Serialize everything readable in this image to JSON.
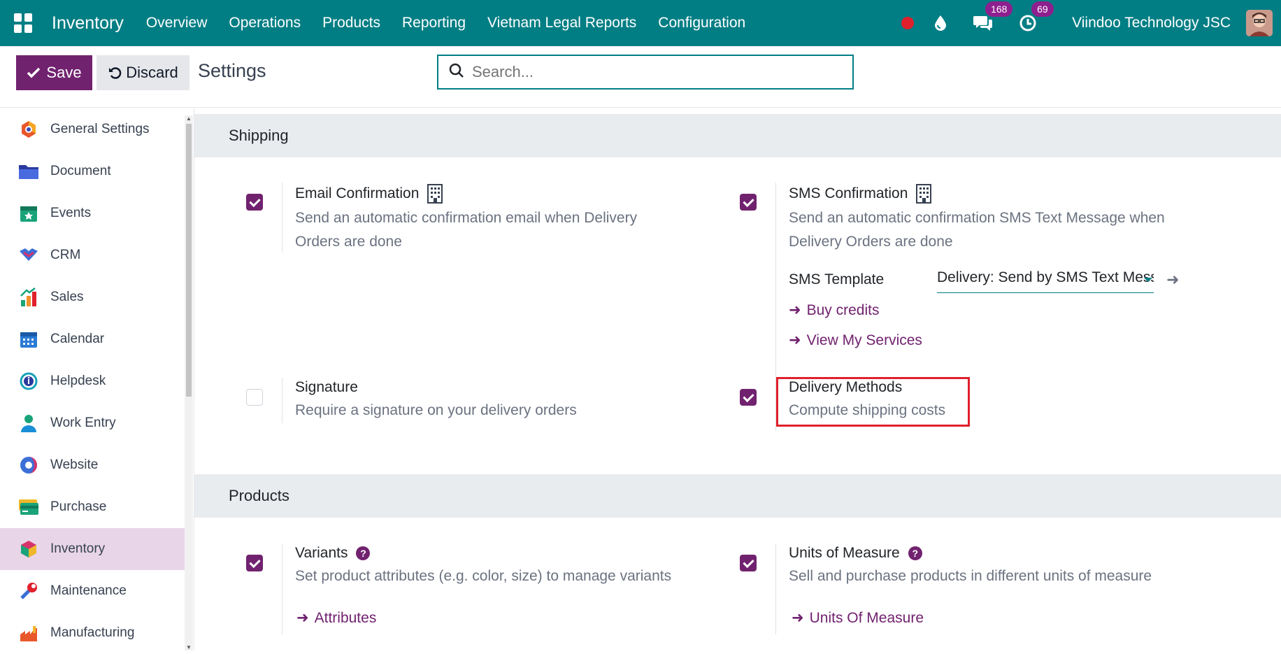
{
  "navbar": {
    "app_name": "Inventory",
    "menu": [
      "Overview",
      "Operations",
      "Products",
      "Reporting",
      "Vietnam Legal Reports",
      "Configuration"
    ],
    "messages_count": "168",
    "activities_count": "69",
    "company": "Viindoo Technology JSC",
    "icons": [
      "apps-grid-icon",
      "recording-dot-icon",
      "droplet-icon",
      "chat-icon",
      "clock-icon"
    ]
  },
  "control": {
    "save_label": "Save",
    "discard_label": "Discard",
    "title": "Settings",
    "search_placeholder": "Search..."
  },
  "sidebar": {
    "items": [
      {
        "label": "General Settings",
        "icon": "general-settings-icon",
        "color": "#e8582b"
      },
      {
        "label": "Document",
        "icon": "document-icon",
        "color": "#3b4cb8"
      },
      {
        "label": "Events",
        "icon": "events-icon",
        "color": "#1aa37a"
      },
      {
        "label": "CRM",
        "icon": "crm-icon",
        "color": "#3b6fd6"
      },
      {
        "label": "Sales",
        "icon": "sales-icon",
        "color": "#f0912b"
      },
      {
        "label": "Calendar",
        "icon": "calendar-icon",
        "color": "#2b7bd6"
      },
      {
        "label": "Helpdesk",
        "icon": "helpdesk-icon",
        "color": "#17a2b8"
      },
      {
        "label": "Work Entry",
        "icon": "work-entry-icon",
        "color": "#1a8fd6"
      },
      {
        "label": "Website",
        "icon": "website-icon",
        "color": "#3b6fd6"
      },
      {
        "label": "Purchase",
        "icon": "purchase-icon",
        "color": "#f0b72b"
      },
      {
        "label": "Inventory",
        "icon": "inventory-icon",
        "color": "#d6336c",
        "active": true
      },
      {
        "label": "Maintenance",
        "icon": "maintenance-icon",
        "color": "#3b6fd6"
      },
      {
        "label": "Manufacturing",
        "icon": "manufacturing-icon",
        "color": "#e8582b"
      }
    ]
  },
  "shipping": {
    "heading": "Shipping",
    "email_confirmation": {
      "title": "Email Confirmation",
      "desc_line1": "Send an automatic confirmation email when Delivery",
      "desc_line2": "Orders are done",
      "checked": true
    },
    "sms_confirmation": {
      "title": "SMS Confirmation",
      "desc_line1": "Send an automatic confirmation SMS Text Message when",
      "desc_line2": "Delivery Orders are done",
      "checked": true,
      "template_label": "SMS Template",
      "template_value": "Delivery: Send by SMS Text Message",
      "buy_credits": "Buy credits",
      "view_services": "View My Services"
    },
    "signature": {
      "title": "Signature",
      "desc": "Require a signature on your delivery orders",
      "checked": false
    },
    "delivery_methods": {
      "title": "Delivery Methods",
      "desc": "Compute shipping costs",
      "checked": true
    }
  },
  "products": {
    "heading": "Products",
    "variants": {
      "title": "Variants",
      "desc": "Set product attributes (e.g. color, size) to manage variants",
      "checked": true,
      "link": "Attributes"
    },
    "uom": {
      "title": "Units of Measure",
      "desc": "Sell and purchase products in different units of measure",
      "checked": true,
      "link": "Units Of Measure"
    }
  },
  "colors": {
    "navbar": "#017e84",
    "primary": "#71226f",
    "highlight": "#e0202c"
  }
}
